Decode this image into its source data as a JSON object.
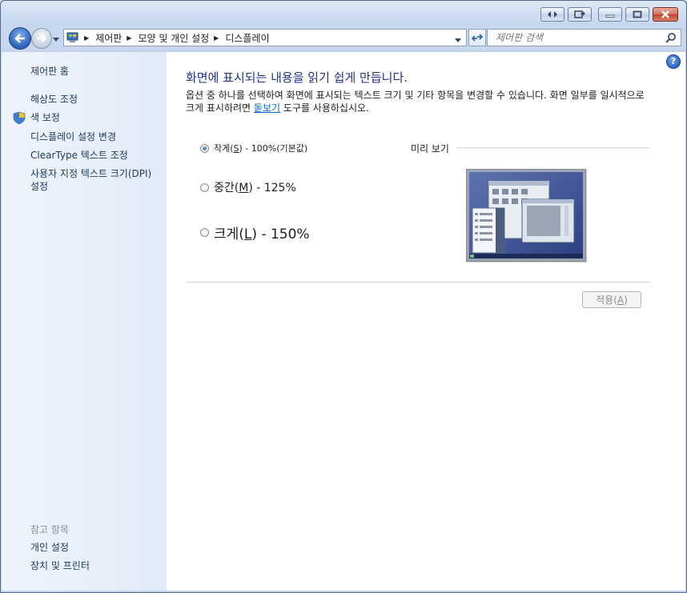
{
  "address": {
    "crumbs": [
      "제어판",
      "모양 및 개인 설정",
      "디스플레이"
    ]
  },
  "search": {
    "placeholder": "제어판 검색"
  },
  "sidebar": {
    "home": "제어판 홈",
    "links": [
      "해상도 조정",
      "색 보정",
      "디스플레이 설정 변경",
      "ClearType 텍스트 조정",
      "사용자 지정 텍스트 크기(DPI) 설정"
    ],
    "see_also_heading": "참고 항목",
    "see_also": [
      "개인 설정",
      "장치 및 프린터"
    ]
  },
  "main": {
    "title": "화면에 표시되는 내용을 읽기 쉽게 만듭니다.",
    "description_before": "옵션 중 하나를 선택하여 화면에 표시되는 텍스트 크기 및 기타 항목을 변경할 수 있습니다. 화면 일부를 일시적으로 크게 표시하려면 ",
    "description_link": "돋보기",
    "description_after": " 도구를 사용하십시오.",
    "options": [
      {
        "pre": "작게(",
        "key": "S",
        "post": ") - 100%(기본값)",
        "checked": true
      },
      {
        "pre": "중간(",
        "key": "M",
        "post": ") - 125%",
        "checked": false
      },
      {
        "pre": "크게(",
        "key": "L",
        "post": ") - 150%",
        "checked": false
      }
    ],
    "preview_label": "미리 보기",
    "apply": {
      "pre": "적용(",
      "key": "A",
      "post": ")"
    }
  }
}
